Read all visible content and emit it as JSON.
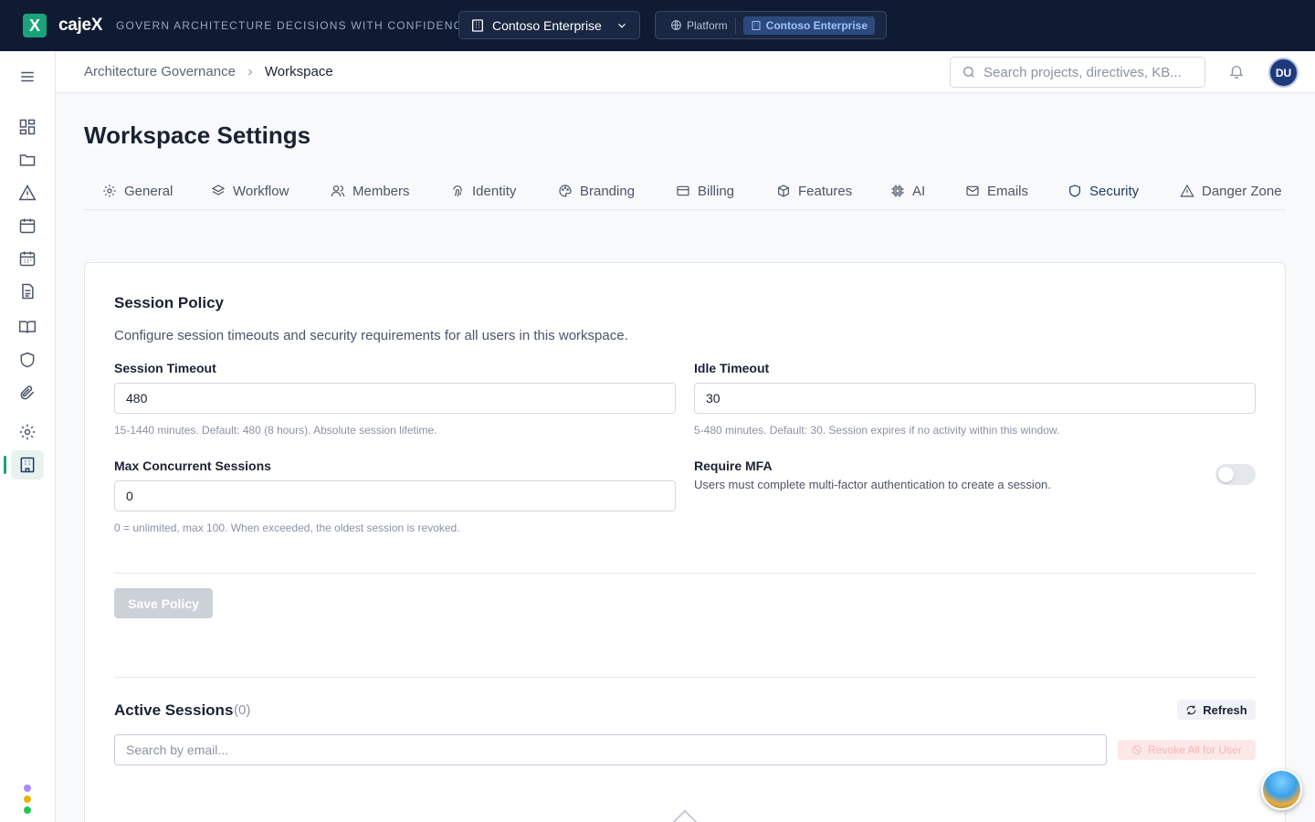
{
  "app": {
    "logo_letter": "X",
    "brand": "cajeX",
    "tagline": "GOVERN ARCHITECTURE DECISIONS WITH CONFIDENCE",
    "workspace_selector": "Contoso Enterprise",
    "scope_platform": "Platform",
    "scope_enterprise": "Contoso Enterprise"
  },
  "header": {
    "breadcrumb_root": "Architecture Governance",
    "breadcrumb_current": "Workspace",
    "search_placeholder": "Search projects, directives, KB...",
    "avatar_initials": "DU"
  },
  "page": {
    "title": "Workspace Settings"
  },
  "tabs": [
    {
      "label": "General",
      "icon": "gear-icon"
    },
    {
      "label": "Workflow",
      "icon": "layers-icon"
    },
    {
      "label": "Members",
      "icon": "users-icon"
    },
    {
      "label": "Identity",
      "icon": "fingerprint-icon"
    },
    {
      "label": "Branding",
      "icon": "palette-icon"
    },
    {
      "label": "Billing",
      "icon": "credit-card-icon"
    },
    {
      "label": "Features",
      "icon": "box-icon"
    },
    {
      "label": "AI",
      "icon": "cpu-icon"
    },
    {
      "label": "Emails",
      "icon": "mail-icon"
    },
    {
      "label": "Security",
      "icon": "shield-icon",
      "active": true
    },
    {
      "label": "Danger Zone",
      "icon": "warning-icon"
    }
  ],
  "session_policy": {
    "title": "Session Policy",
    "description": "Configure session timeouts and security requirements for all users in this workspace.",
    "session_timeout_label": "Session Timeout",
    "session_timeout_value": "480",
    "session_timeout_help": "15-1440 minutes. Default: 480 (8 hours). Absolute session lifetime.",
    "idle_timeout_label": "Idle Timeout",
    "idle_timeout_value": "30",
    "idle_timeout_help": "5-480 minutes. Default: 30. Session expires if no activity within this window.",
    "max_sessions_label": "Max Concurrent Sessions",
    "max_sessions_value": "0",
    "max_sessions_help": "0 = unlimited, max 100. When exceeded, the oldest session is revoked.",
    "mfa_label": "Require MFA",
    "mfa_description": "Users must complete multi-factor authentication to create a session.",
    "mfa_enabled": false,
    "save_label": "Save Policy"
  },
  "active_sessions": {
    "title": "Active Sessions",
    "count": "(0)",
    "refresh_label": "Refresh",
    "search_placeholder": "Search by email...",
    "revoke_label": "Revoke All for User"
  },
  "colors": {
    "topbar": "#0f1b33",
    "accent": "#1aa37a",
    "active_tab": "#1e3a5f"
  }
}
